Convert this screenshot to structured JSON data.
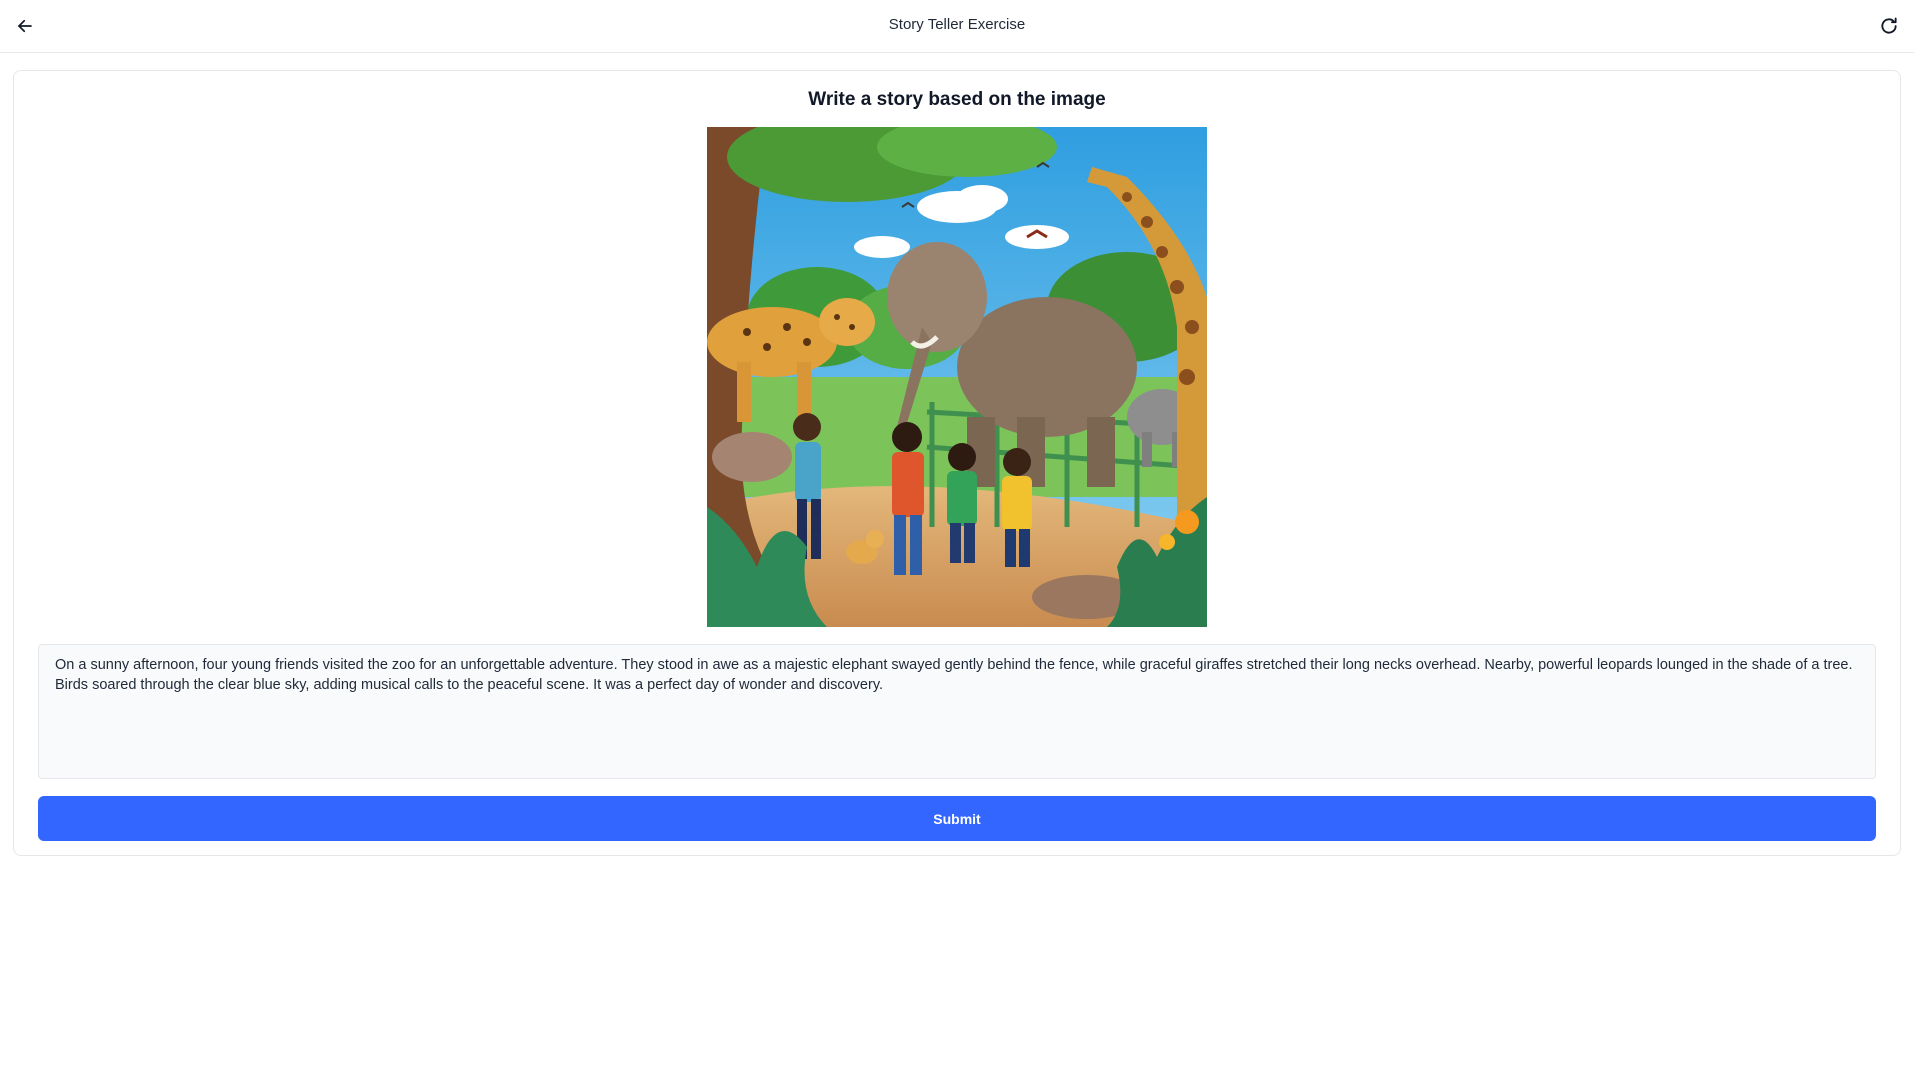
{
  "header": {
    "title": "Story Teller Exercise",
    "back_icon": "arrow-left-icon",
    "refresh_icon": "refresh-icon"
  },
  "exercise": {
    "heading": "Write a story based on the image",
    "story_text": "On a sunny afternoon, four young friends visited the zoo for an unforgettable adventure. They stood in awe as a majestic elephant swayed gently behind the fence, while graceful giraffes stretched their long necks overhead. Nearby, powerful leopards lounged in the shade of a tree. Birds soared through the clear blue sky, adding musical calls to the peaceful scene. It was a perfect day of wonder and discovery.",
    "submit_label": "Submit"
  },
  "colors": {
    "accent": "#3366ff",
    "border": "#e5e7eb",
    "textarea_bg": "#f8fafc"
  }
}
